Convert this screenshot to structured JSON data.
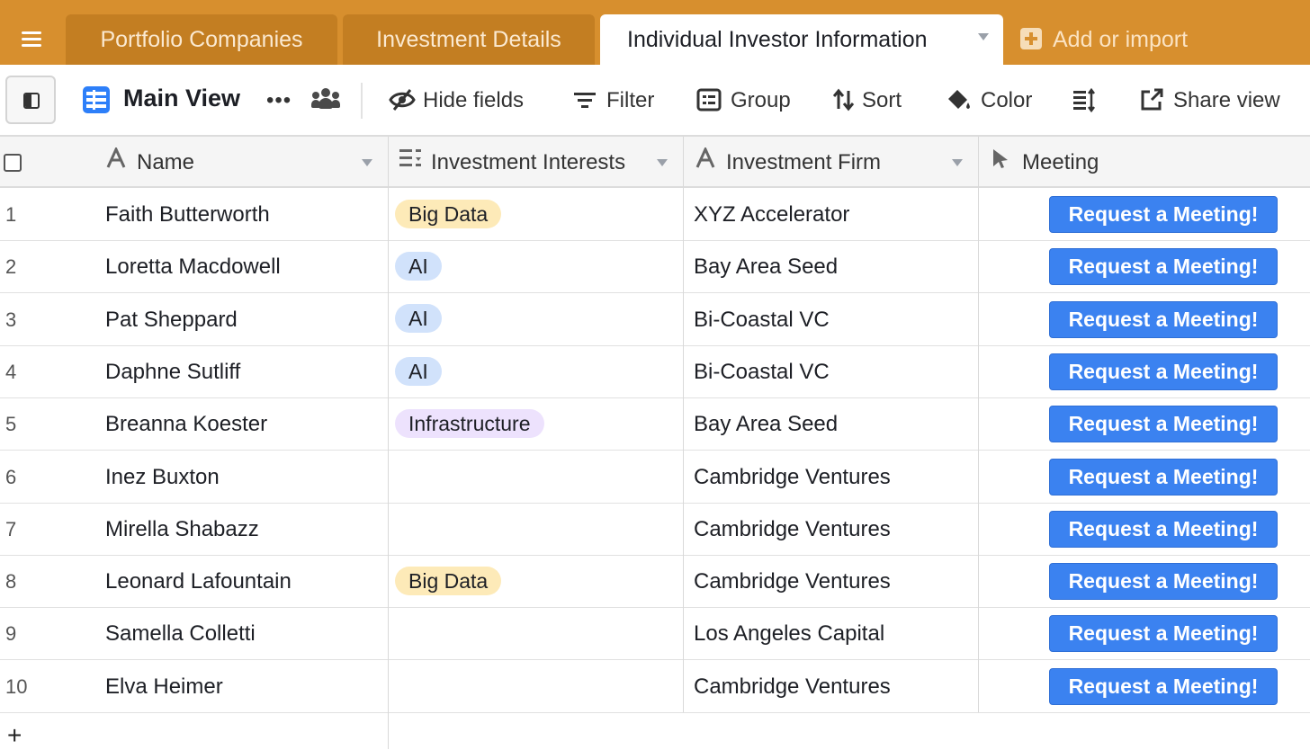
{
  "tabs": [
    {
      "label": "Portfolio Companies",
      "active": false
    },
    {
      "label": "Investment Details",
      "active": false
    },
    {
      "label": "Individual Investor Information",
      "active": true
    }
  ],
  "add_import_label": "Add or import",
  "toolbar": {
    "view_name": "Main View",
    "more_label": "•••",
    "hide_fields": "Hide fields",
    "filter": "Filter",
    "group": "Group",
    "sort": "Sort",
    "color": "Color",
    "share_view": "Share view"
  },
  "columns": [
    {
      "label": "Name",
      "icon": "text-field-icon"
    },
    {
      "label": "Investment Interests",
      "icon": "multi-select-icon"
    },
    {
      "label": "Investment Firm",
      "icon": "text-field-icon"
    },
    {
      "label": "Meeting",
      "icon": "button-field-icon"
    }
  ],
  "colors": {
    "brand": "#d78f2e",
    "button": "#3b82f0",
    "chip_big_data": "#fdeab8",
    "chip_ai": "#d1e2fb",
    "chip_infrastructure": "#ede2fd"
  },
  "chip_styles": {
    "Big Data": "#fdeab8",
    "AI": "#d1e2fb",
    "Infrastructure": "#ede2fd"
  },
  "rows": [
    {
      "num": "1",
      "name": "Faith Butterworth",
      "interest": "Big Data",
      "firm": "XYZ Accelerator",
      "meeting": "Request a Meeting!"
    },
    {
      "num": "2",
      "name": "Loretta Macdowell",
      "interest": "AI",
      "firm": "Bay Area Seed",
      "meeting": "Request a Meeting!"
    },
    {
      "num": "3",
      "name": "Pat Sheppard",
      "interest": "AI",
      "firm": "Bi-Coastal VC",
      "meeting": "Request a Meeting!"
    },
    {
      "num": "4",
      "name": "Daphne Sutliff",
      "interest": "AI",
      "firm": "Bi-Coastal VC",
      "meeting": "Request a Meeting!"
    },
    {
      "num": "5",
      "name": "Breanna Koester",
      "interest": "Infrastructure",
      "firm": "Bay Area Seed",
      "meeting": "Request a Meeting!"
    },
    {
      "num": "6",
      "name": "Inez Buxton",
      "interest": "",
      "firm": "Cambridge Ventures",
      "meeting": "Request a Meeting!"
    },
    {
      "num": "7",
      "name": "Mirella Shabazz",
      "interest": "",
      "firm": "Cambridge Ventures",
      "meeting": "Request a Meeting!"
    },
    {
      "num": "8",
      "name": "Leonard Lafountain",
      "interest": "Big Data",
      "firm": "Cambridge Ventures",
      "meeting": "Request a Meeting!"
    },
    {
      "num": "9",
      "name": "Samella Colletti",
      "interest": "",
      "firm": "Los Angeles Capital",
      "meeting": "Request a Meeting!"
    },
    {
      "num": "10",
      "name": "Elva Heimer",
      "interest": "",
      "firm": "Cambridge Ventures",
      "meeting": "Request a Meeting!"
    }
  ],
  "add_row_label": "+"
}
